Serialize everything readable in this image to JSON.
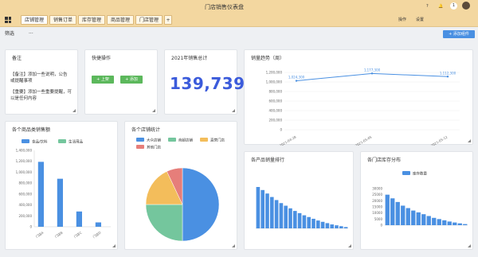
{
  "app": {
    "title": "门店销售仪表盘",
    "user_badge": "1",
    "hdr_icon_label": "帮助"
  },
  "tabs": [
    {
      "label": "店铺管理"
    },
    {
      "label": "销售订单"
    },
    {
      "label": "库存管理"
    },
    {
      "label": "商品管理"
    },
    {
      "label": "门店管理"
    }
  ],
  "tab_add": "+",
  "header_right": {
    "label1": "操作",
    "label2": "设置"
  },
  "toolbar": {
    "filter_label": "筛选",
    "more_label": "···",
    "add_button": "+ 添加组件"
  },
  "cards": {
    "notes": {
      "title": "备注",
      "lines": [
        "【备注】添加一些说明，公告",
        "或提醒事项",
        "【重要】添加一些重要提醒，可",
        "以是任何内容"
      ]
    },
    "quick": {
      "title": "快捷操作",
      "btn1": "+ 上架",
      "btn2": "+ 添加"
    },
    "total": {
      "title": "2021年销售总计",
      "value": "139,739"
    },
    "trend": {
      "title": "销量趋势（周）"
    },
    "bar_store": {
      "title": "各个商品类销售额"
    },
    "pie": {
      "title": "各个店铺统计"
    },
    "rank": {
      "title": "各产品销量排行"
    },
    "stock": {
      "title": "各门店库存分布"
    }
  },
  "chart_data": [
    {
      "type": "line",
      "title": "销量趋势（周）",
      "x": [
        "2021-04-28",
        "2021-05-05",
        "2021-05-12"
      ],
      "series": [
        {
          "values": [
            1024300,
            1177300,
            1112300
          ],
          "labels": [
            "1,024,300",
            "1,177,300",
            "1,112,300"
          ]
        }
      ],
      "y_ticks": [
        "1,200,000",
        "1,000,000",
        "800,000",
        "600,000",
        "400,000",
        "200,000",
        "0"
      ],
      "ylim": [
        0,
        1200000
      ]
    },
    {
      "type": "bar",
      "title": "各个商品类销售额",
      "legend": [
        "食品/饮料",
        "生活用品"
      ],
      "colors": [
        "#4a90e2",
        "#74c69d"
      ],
      "categories": [
        "门店A",
        "门店B",
        "门店C",
        "门店D"
      ],
      "series": [
        {
          "name": "食品/饮料",
          "values": [
            1190000,
            880000,
            280000,
            80000
          ]
        },
        {
          "name": "生活用品",
          "values": [
            0,
            0,
            0,
            0
          ]
        }
      ],
      "y_ticks": [
        "1,400,000",
        "1,200,000",
        "1,000,000",
        "800,000",
        "600,000",
        "400,000",
        "200,000",
        "0"
      ],
      "ylim": [
        0,
        1400000
      ]
    },
    {
      "type": "pie",
      "title": "各个店铺统计",
      "legend": [
        "大众店铺",
        "商超店铺",
        "直营门店",
        "其他门店"
      ],
      "colors": [
        "#4a90e2",
        "#74c69d",
        "#f3bd5b",
        "#e67e7a"
      ],
      "values": [
        50,
        25,
        18,
        7
      ]
    },
    {
      "type": "bar",
      "title": "各产品销量排行",
      "colors": [
        "#4a90e2"
      ],
      "values": [
        95,
        88,
        80,
        72,
        65,
        58,
        52,
        46,
        40,
        35,
        30,
        26,
        22,
        18,
        15,
        12,
        9,
        7,
        5,
        3
      ]
    },
    {
      "type": "bar",
      "title": "各门店库存分布",
      "legend": [
        "库存数量"
      ],
      "colors": [
        "#4a90e2"
      ],
      "y_ticks": [
        "30000",
        "25000",
        "20000",
        "15000",
        "10000",
        "5000",
        "0"
      ],
      "ylim": [
        0,
        30000
      ],
      "values": [
        25000,
        22000,
        19000,
        16000,
        14000,
        12000,
        10500,
        9000,
        7500,
        6000,
        5000,
        4000,
        3000,
        2200,
        1500,
        900
      ]
    }
  ]
}
